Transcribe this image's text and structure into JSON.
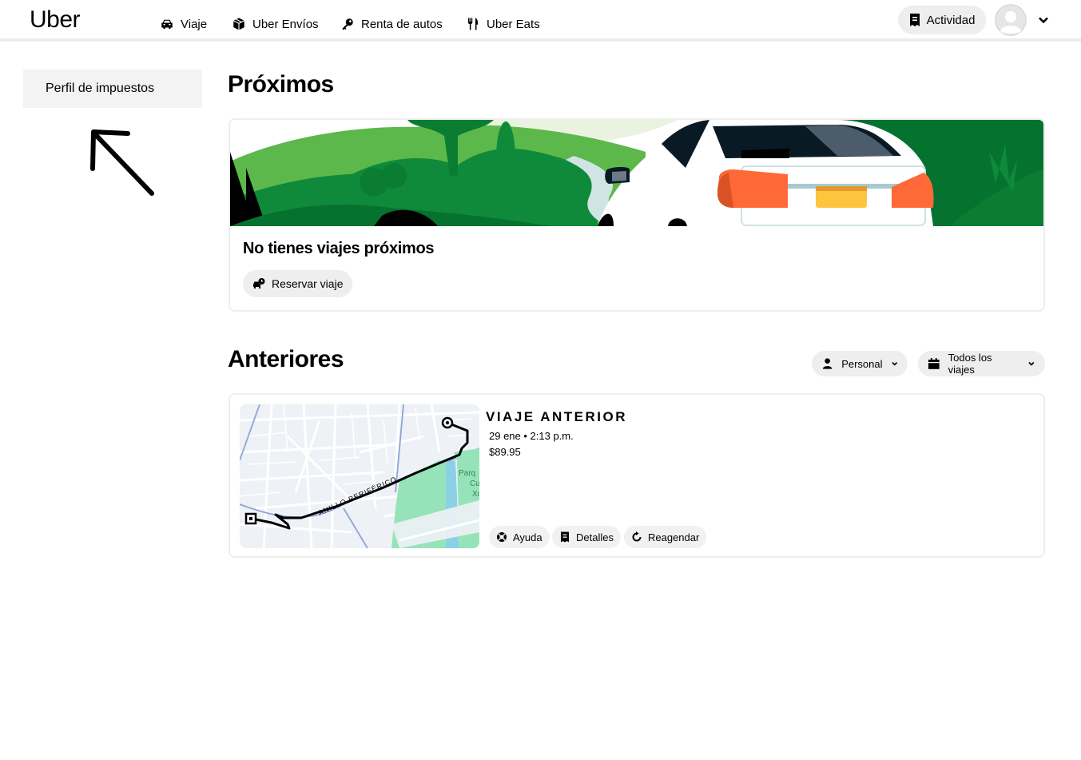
{
  "header": {
    "logo": "Uber",
    "nav": [
      {
        "label": "Viaje",
        "icon": "car-icon"
      },
      {
        "label": "Uber Envíos",
        "icon": "package-icon"
      },
      {
        "label": "Renta de autos",
        "icon": "key-icon"
      },
      {
        "label": "Uber Eats",
        "icon": "utensils-icon"
      }
    ],
    "activity_label": "Actividad",
    "activity_icon": "receipt-icon",
    "avatar_icon": "user-avatar-icon",
    "account_menu_icon": "chevron-down-icon"
  },
  "sidebar": {
    "items": [
      {
        "label": "Perfil de impuestos"
      }
    ]
  },
  "upcoming": {
    "title": "Próximos",
    "empty_message": "No tienes viajes próximos",
    "book_button": "Reservar viaje"
  },
  "past": {
    "title": "Anteriores",
    "filter_profile": "Personal",
    "filter_trips": "Todos los viajes",
    "trips": [
      {
        "label": "VIAJE ANTERIOR",
        "date": "29 ene • 2:13 p.m.",
        "price": "$89.95",
        "map_road_label": "ANILLO PERIFÉRICO",
        "map_park_label": "Parq Cu Xo",
        "actions": [
          "Ayuda",
          "Detalles",
          "Reagendar"
        ]
      }
    ]
  },
  "colors": {
    "pill_bg": "#eeeeee",
    "sidebar_active_bg": "#f3f3f3",
    "banner_green_dark": "#06722f",
    "banner_green": "#0e8a3a",
    "banner_green_light": "#5cb84a",
    "tail_light": "#ff6937",
    "plate": "#ffc43d"
  }
}
